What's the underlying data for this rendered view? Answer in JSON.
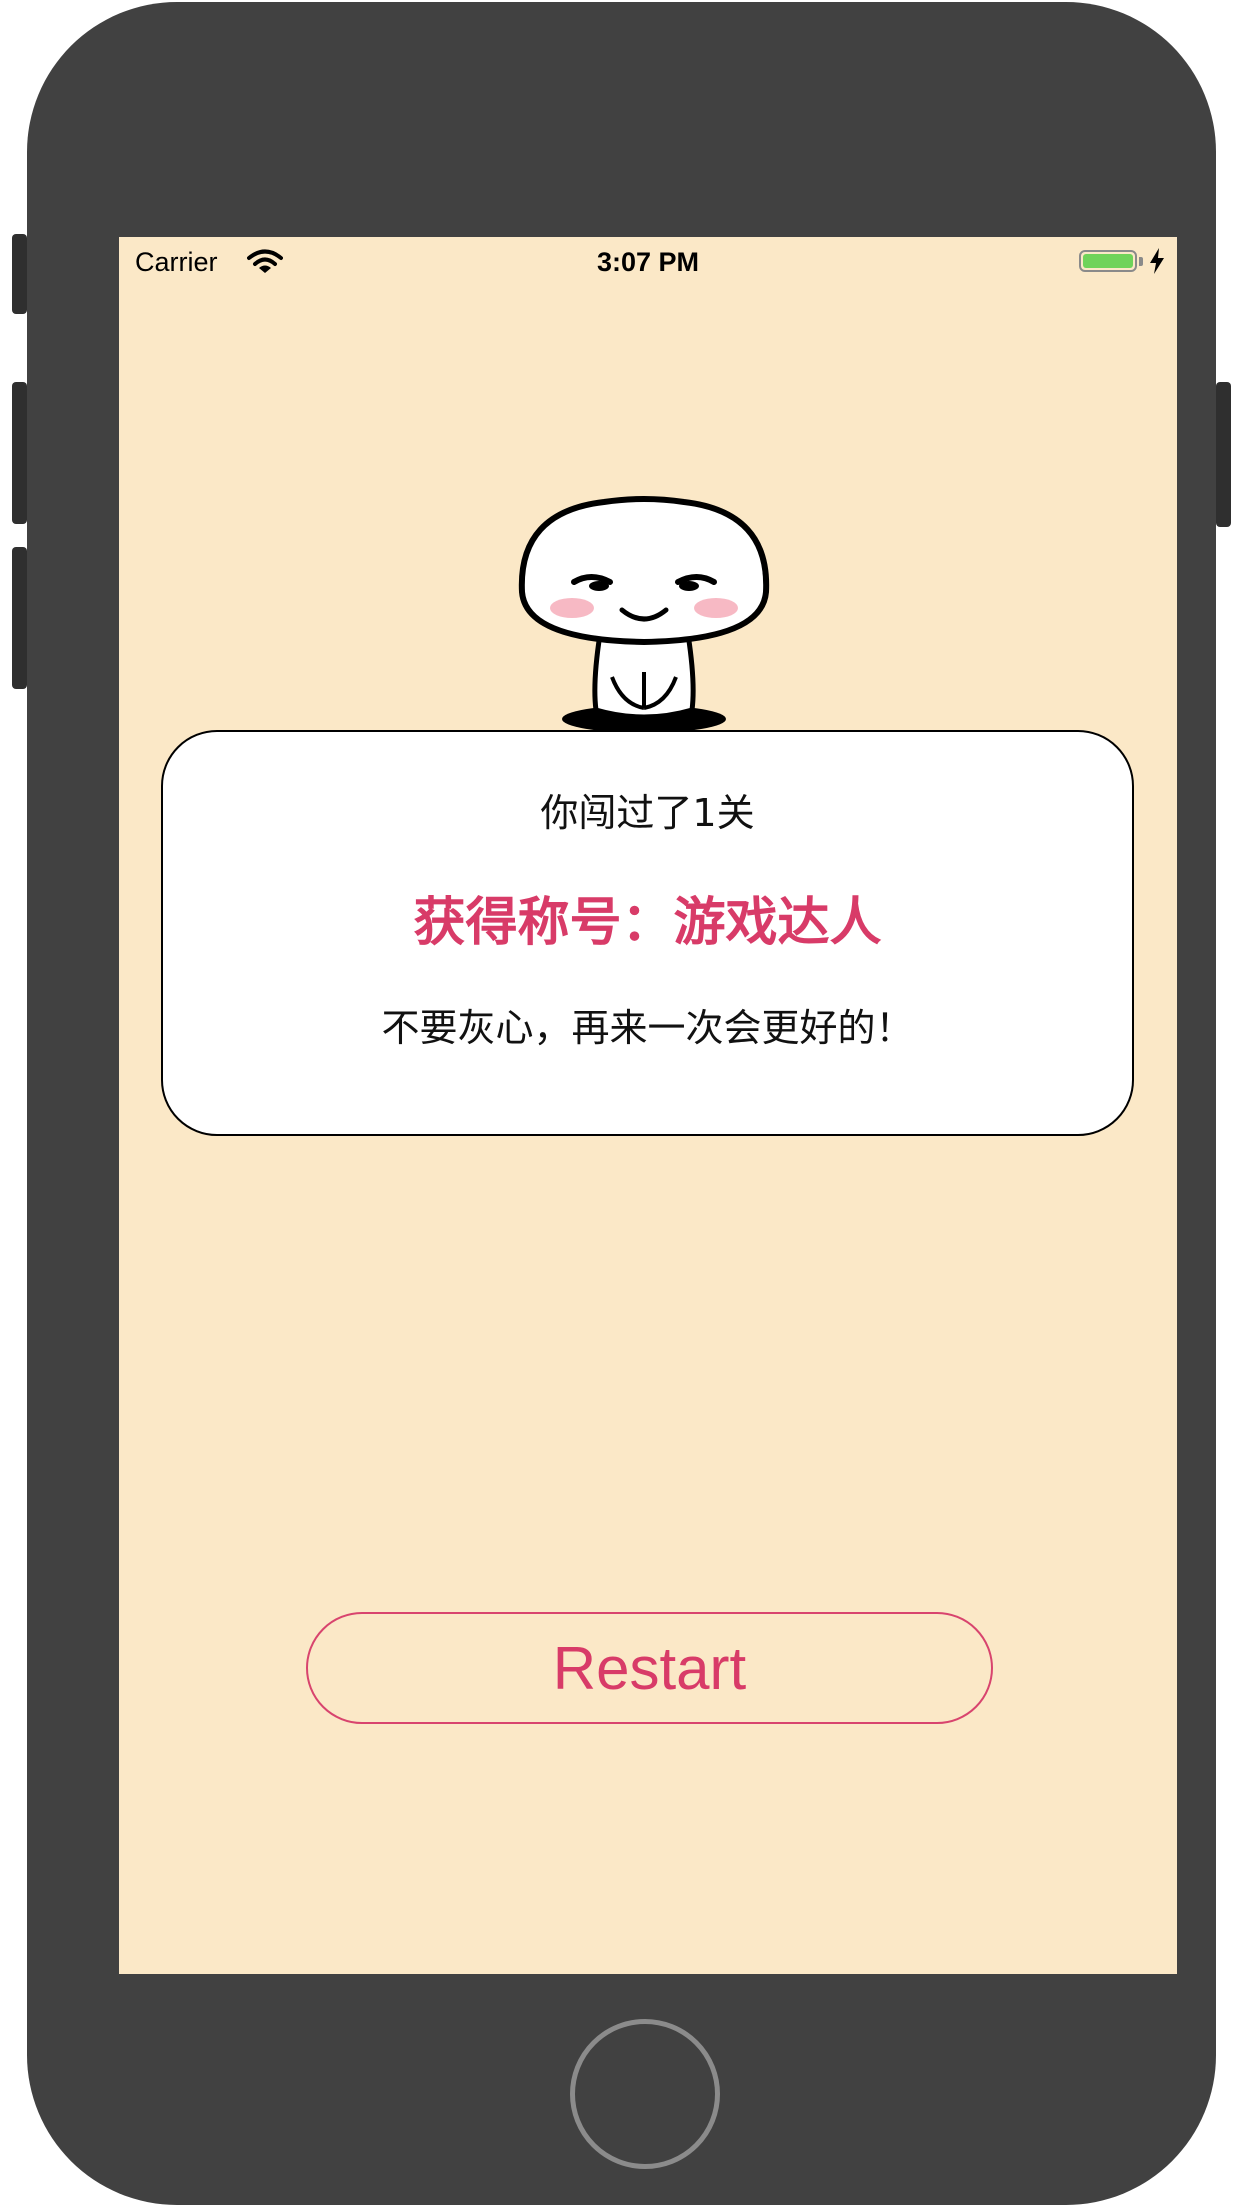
{
  "status_bar": {
    "carrier": "Carrier",
    "time": "3:07 PM",
    "battery_color": "#6fd35a"
  },
  "result_card": {
    "levels_text": "你闯过了1关",
    "title_text": "获得称号：游戏达人",
    "encourage_text": "不要灰心，再来一次会更好的！"
  },
  "restart_button": {
    "label": "Restart"
  },
  "colors": {
    "screen_background": "#fbe8c7",
    "accent": "#d83b68",
    "device_frame": "#414141"
  },
  "icons": [
    "wifi-icon",
    "battery-icon",
    "charging-bolt-icon",
    "mascot-image",
    "home-button"
  ]
}
